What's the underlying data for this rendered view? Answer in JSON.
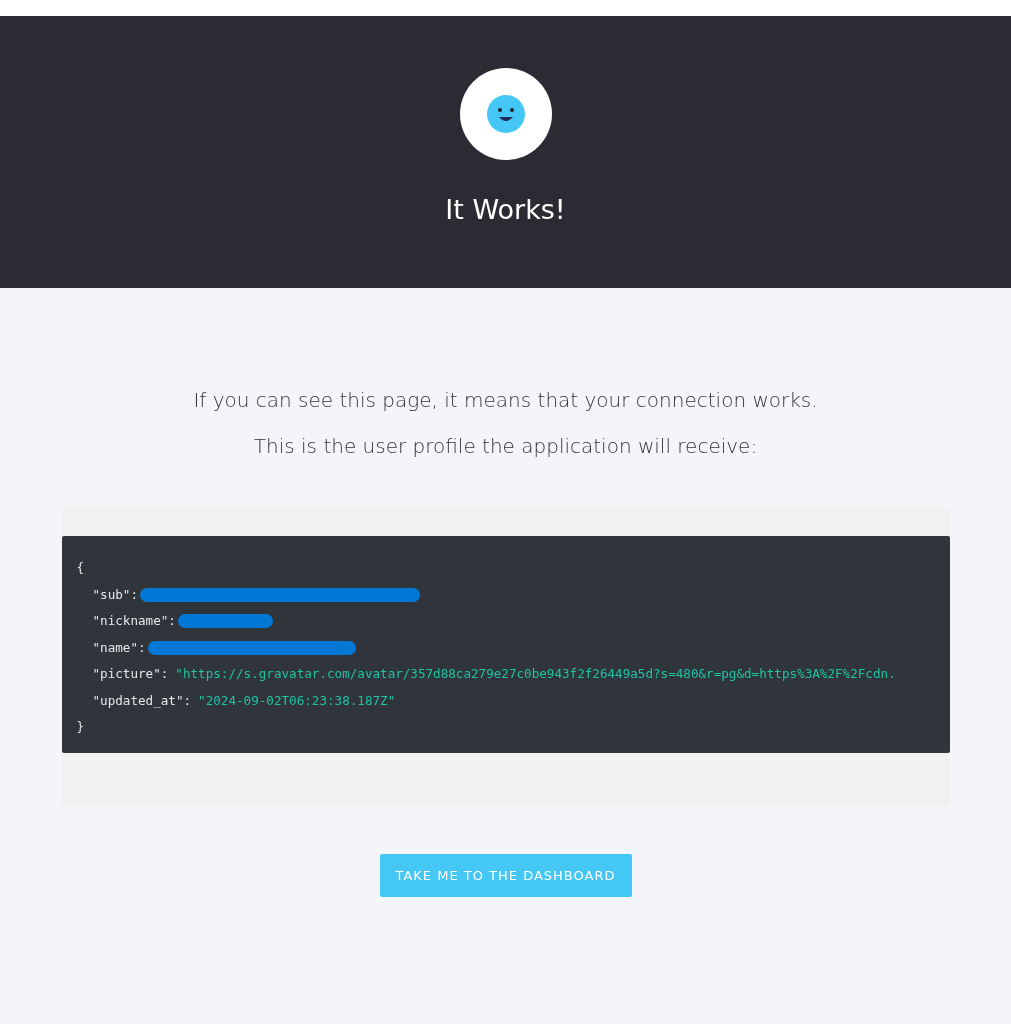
{
  "header": {
    "title": "It Works!"
  },
  "intro": [
    "If you can see this page, it means that your connection works.",
    "This is the user profile the application will receive:"
  ],
  "profile": {
    "open": "{",
    "close": "}",
    "entries": [
      {
        "key": "\"sub\":",
        "kind": "redacted"
      },
      {
        "key": "\"nickname\":",
        "kind": "redacted"
      },
      {
        "key": "\"name\":",
        "kind": "redacted"
      },
      {
        "key": "\"picture\":",
        "kind": "value",
        "value": "\"https://s.gravatar.com/avatar/357d88ca279e27c0be943f2f26449a5d?s=480&r=pg&d=https%3A%2F%2Fcdn."
      },
      {
        "key": "\"updated_at\":",
        "kind": "value",
        "value": "\"2024-09-02T06:23:38.187Z\""
      }
    ]
  },
  "button": {
    "label": "TAKE ME TO THE DASHBOARD"
  }
}
